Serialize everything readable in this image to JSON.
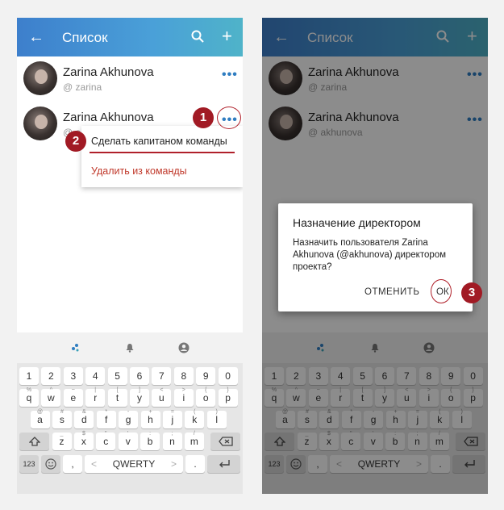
{
  "appbar": {
    "title": "Список",
    "back_icon": "arrow-left-icon",
    "search_icon": "search-icon",
    "add_icon": "plus-icon"
  },
  "users": [
    {
      "name": "Zarina Akhunova",
      "username": "@ zarina",
      "more": "•••"
    },
    {
      "name": "Zarina Akhunova",
      "username": "@ akhunova",
      "more": "•••"
    }
  ],
  "menu": {
    "make_captain": "Сделать капитаном команды",
    "remove": "Удалить из команды"
  },
  "dialog": {
    "title": "Назначение директором",
    "body": "Назначить пользователя Zarina Akhunova (@akhunova) директором проекта?",
    "cancel": "ОТМЕНИТЬ",
    "ok": "ОК"
  },
  "steps": [
    "1",
    "2",
    "3"
  ],
  "keyboard": {
    "row_numbers": [
      "1",
      "2",
      "3",
      "4",
      "5",
      "6",
      "7",
      "8",
      "9",
      "0"
    ],
    "row1": [
      "q",
      "w",
      "e",
      "r",
      "t",
      "y",
      "u",
      "i",
      "o",
      "p"
    ],
    "row1_hints": [
      "%",
      "^",
      "~",
      "|",
      "[",
      "]",
      "<",
      ">",
      "{",
      "}"
    ],
    "row2": [
      "a",
      "s",
      "d",
      "f",
      "g",
      "h",
      "j",
      "k",
      "l"
    ],
    "row2_hints": [
      "@",
      "#",
      "&",
      "*",
      "-",
      "+",
      "=",
      "(",
      ")"
    ],
    "row3": [
      "z",
      "x",
      "c",
      "v",
      "b",
      "n",
      "m"
    ],
    "row3_hints": [
      "_",
      "$",
      "\"",
      "'",
      ":",
      ";",
      "/"
    ],
    "fn_123": "123",
    "space": "QWERTY",
    "space_arrows": [
      "<",
      ">"
    ],
    "comma": ",",
    "period": ".",
    "shift_icon": "shift-icon",
    "backspace_icon": "backspace-icon",
    "emoji_icon": "emoji-icon",
    "enter_icon": "enter-icon",
    "suggest_icons": [
      "sparkle-icon",
      "bell-icon",
      "account-icon"
    ]
  },
  "colors": {
    "appbar_start": "#3d7fcc",
    "appbar_end": "#4fb3c9",
    "accent": "#2f7dc1",
    "badge": "#a11a24",
    "danger": "#c0392b"
  }
}
